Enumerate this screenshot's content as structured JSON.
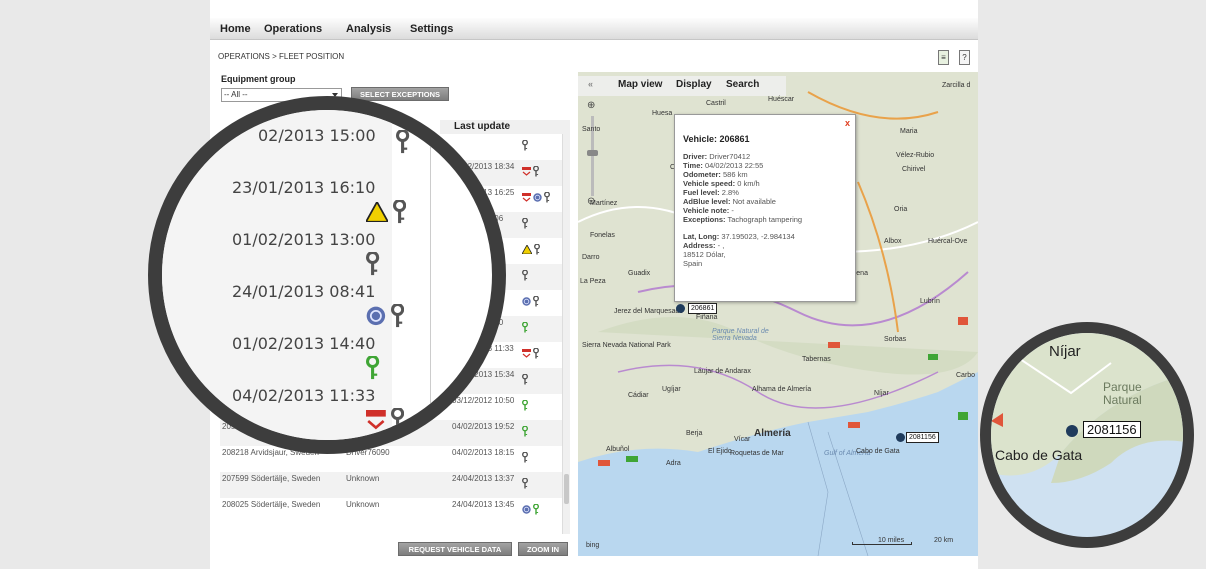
{
  "nav": {
    "items": [
      "Home",
      "Operations",
      "Analysis",
      "Settings"
    ]
  },
  "breadcrumb": "OPERATIONS > FLEET POSITION",
  "filter": {
    "label": "Equipment group",
    "selected": "-- All --",
    "exceptions_button": "SELECT EXCEPTIONS"
  },
  "table": {
    "last_update_header": "Last update",
    "rows": [
      {
        "location": "",
        "driver": "",
        "last_update": "",
        "icons": [
          "key-grey"
        ]
      },
      {
        "location": "",
        "driver": "",
        "last_update": "04/02/2013 18:34",
        "icons": [
          "tacho-red",
          "key-grey"
        ]
      },
      {
        "location": "",
        "driver": "",
        "last_update": "07/03/2013 16:25",
        "icons": [
          "tacho-red",
          "gauge",
          "key-grey"
        ]
      },
      {
        "location": "",
        "driver": "",
        "last_update": "02/2013 15:06",
        "icons": [
          "key-grey"
        ]
      },
      {
        "location": "",
        "driver": "",
        "last_update": "01/2013 16:10",
        "icons": [
          "warning",
          "key-grey"
        ]
      },
      {
        "location": "",
        "driver": "",
        "last_update": "2013 13:00",
        "icons": [
          "key-grey"
        ]
      },
      {
        "location": "",
        "driver": "",
        "last_update": "2013 08:41",
        "icons": [
          "gauge",
          "key-grey"
        ]
      },
      {
        "location": "",
        "driver": "",
        "last_update": "02/2013 14:40",
        "icons": [
          "key-green"
        ]
      },
      {
        "location": "",
        "driver": "",
        "last_update": "04/02/2013 11:33",
        "icons": [
          "tacho-red",
          "key-grey"
        ]
      },
      {
        "location": "",
        "driver": "",
        "last_update": "04/02/2013 15:34",
        "icons": [
          "key-grey"
        ]
      },
      {
        "location": "Södertälje, Sweden",
        "driver": "",
        "last_update": "03/12/2012 10:50",
        "icons": [
          "key-green"
        ]
      },
      {
        "location": "205923 Arvidsjaur, Sweden",
        "driver": "Driver76089",
        "last_update": "04/02/2013 19:52",
        "icons": [
          "key-green"
        ]
      },
      {
        "location": "208218 Arvidsjaur, Sweden",
        "driver": "Driver76090",
        "last_update": "04/02/2013 18:15",
        "icons": [
          "key-grey"
        ]
      },
      {
        "location": "207599 Södertälje, Sweden",
        "driver": "Unknown",
        "last_update": "24/04/2013 13:37",
        "icons": [
          "key-grey"
        ]
      },
      {
        "location": "208025 Södertälje, Sweden",
        "driver": "Unknown",
        "last_update": "24/04/2013 13:45",
        "icons": [
          "gauge",
          "key-green"
        ]
      }
    ]
  },
  "buttons": {
    "request": "REQUEST VEHICLE DATA",
    "zoom": "ZOOM IN"
  },
  "map": {
    "tabs": [
      "Map view",
      "Display",
      "Search"
    ],
    "labels": [
      "Castril",
      "Huéscar",
      "Zarcilla d",
      "Huesa",
      "Santo",
      "Maria",
      "Vélez-Rubio",
      "Cuevas",
      "Chirivel",
      "Martínez",
      "Oria",
      "Fonelas",
      "Albox",
      "Huércal-Ove",
      "Darro",
      "Guadix",
      "Purchena",
      "Lubrín",
      "La Peza",
      "Jerez del Marquesado",
      "Fiñana",
      "Parque Natural de Sierra Nevada",
      "Sierra Nevada National Park",
      "Tabernas",
      "Sorbas",
      "Láujar de Andarax",
      "Ugíjar",
      "Cádiar",
      "Alhama de Almería",
      "Níjar",
      "Berja",
      "Vícar",
      "Almería",
      "Albuñol",
      "Adra",
      "El Ejido",
      "Roquetas de Mar",
      "Gulf of Almería",
      "Cabo de Gata",
      "Carbo",
      "bing",
      "10 miles",
      "20 km"
    ],
    "popup": {
      "title": "Vehicle: 206861",
      "close": "x",
      "driver": "Driver70412",
      "time": "04/02/2013 22:55",
      "odometer": "586 km",
      "speed": "0 km/h",
      "fuel": "2.8%",
      "adblue": "Not available",
      "note": "-",
      "exceptions": "Tachograph tampering",
      "latlong": "37.195023, -2.984134",
      "address": "- ,",
      "address2": "18512 Dólar,",
      "address3": "Spain",
      "field_labels": {
        "driver": "Driver:",
        "time": "Time:",
        "odometer": "Odometer:",
        "speed": "Vehicle speed:",
        "fuel": "Fuel level:",
        "adblue": "AdBlue level:",
        "note": "Vehicle note:",
        "exceptions": "Exceptions:",
        "latlong": "Lat, Long:",
        "address": "Address:"
      }
    },
    "markers": [
      "206861",
      "2081156"
    ]
  },
  "zoom_big": {
    "rows": [
      {
        "date": "02/2013 15:00",
        "icons": [
          "key-grey"
        ]
      },
      {
        "date": "23/01/2013 16:10",
        "icons": [
          "warning",
          "key-grey"
        ]
      },
      {
        "date": "01/02/2013 13:00",
        "icons": [
          "key-grey"
        ]
      },
      {
        "date": "24/01/2013 08:41",
        "icons": [
          "gauge",
          "key-grey"
        ]
      },
      {
        "date": "01/02/2013 14:40",
        "icons": [
          "key-green"
        ]
      },
      {
        "date": "04/02/2013 11:33",
        "icons": [
          "tacho-red",
          "key-grey"
        ]
      }
    ]
  },
  "zoom_small": {
    "labels": [
      "Níjar",
      "Parque Natural",
      "Cabo de Gata"
    ],
    "marker": "2081156"
  },
  "colors": {
    "accent_blue": "#1f3b5c",
    "key_grey": "#555555",
    "key_green": "#3fa535",
    "warn": "#f0d000",
    "tacho_red": "#d0302a"
  }
}
